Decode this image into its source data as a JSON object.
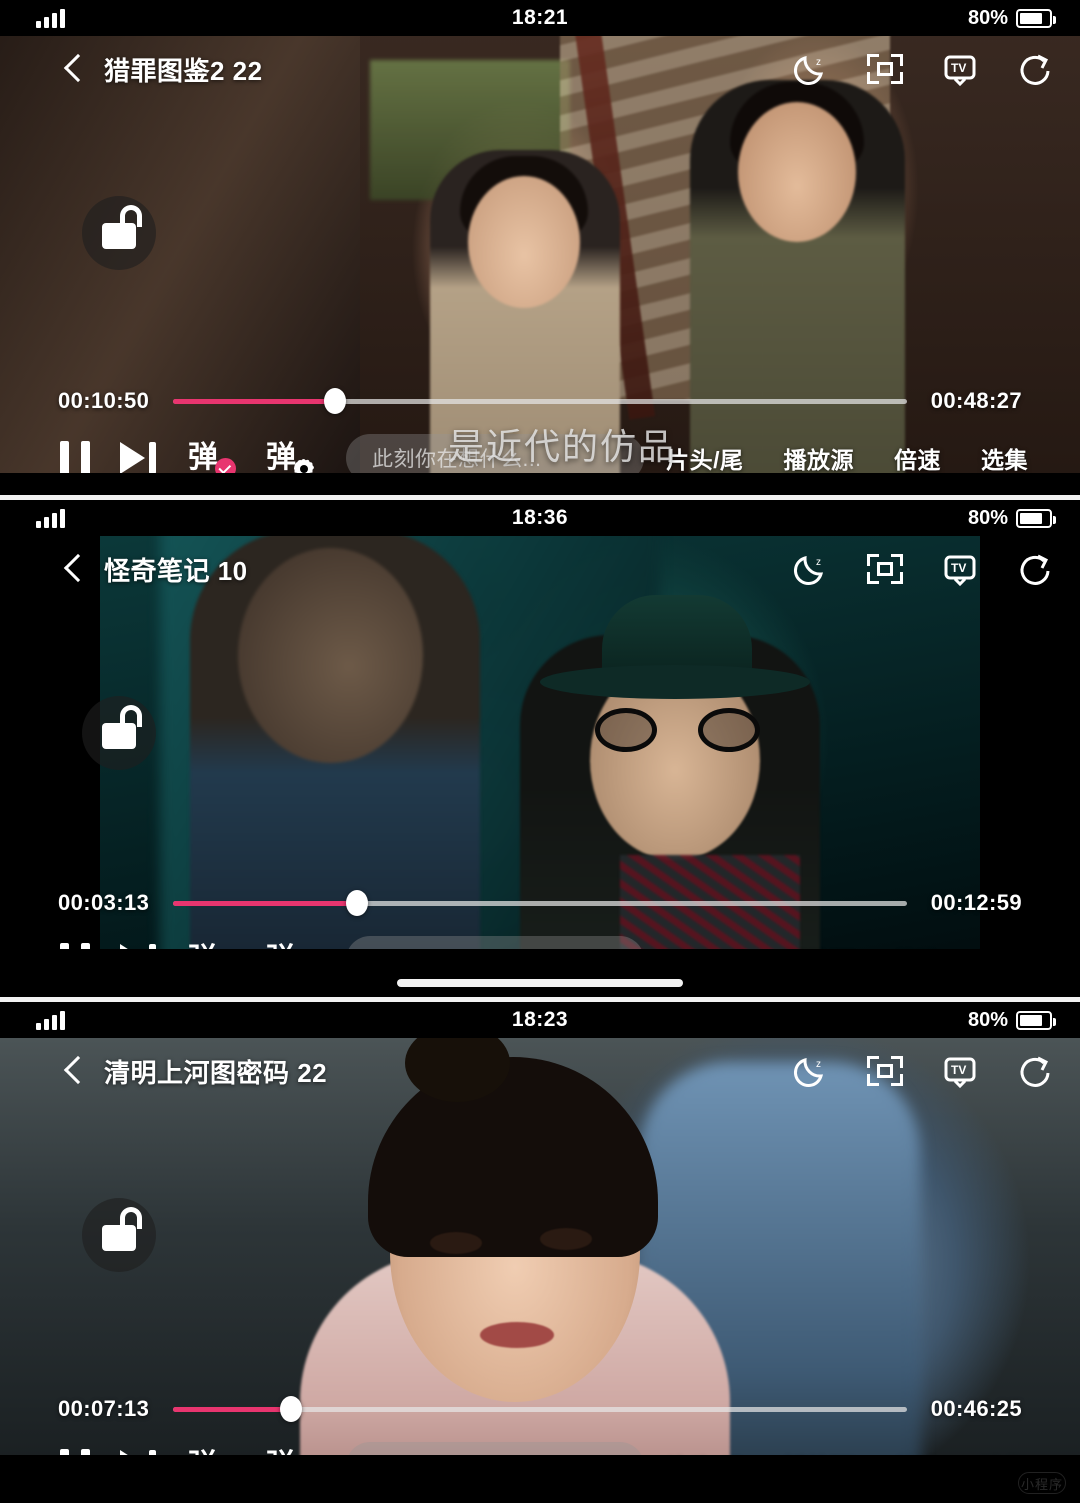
{
  "common": {
    "battery_text": "80%",
    "signal_icon": "signal-bars-icon",
    "battery_icon": "battery-icon",
    "back_icon": "back-chevron-icon",
    "lock_icon": "unlock-padlock-icon",
    "top_icons": [
      {
        "name": "sleep-timer-icon",
        "label": "sleep-timer"
      },
      {
        "name": "screen-crop-icon",
        "label": "screen-crop"
      },
      {
        "name": "tv-cast-icon",
        "label": "tv-cast"
      },
      {
        "name": "share-icon",
        "label": "share"
      }
    ],
    "controls": {
      "pause_icon": "pause-icon",
      "next_episode_icon": "next-episode-icon",
      "danmaku_toggle_label": "弹",
      "danmaku_settings_label": "弹",
      "input_placeholder": "此刻你在想什么...",
      "input_value": ""
    },
    "menu": {
      "skip_intro_outro": "片头/尾",
      "play_source": "播放源",
      "speed": "倍速",
      "episodes": "选集"
    },
    "accent_color": "#e8356f",
    "watermark": "小程序"
  },
  "panels": [
    {
      "status_time": "18:21",
      "title": "猎罪图鉴2 22",
      "current_time": "00:10:50",
      "total_time": "00:48:27",
      "progress_percent": 22,
      "danmaku_comment": "是近代的仿品",
      "has_home_indicator": false,
      "letterboxed": false
    },
    {
      "status_time": "18:36",
      "title": "怪奇笔记 10",
      "current_time": "00:03:13",
      "total_time": "00:12:59",
      "progress_percent": 25,
      "danmaku_comment": "",
      "has_home_indicator": true,
      "letterboxed": true
    },
    {
      "status_time": "18:23",
      "title": "清明上河图密码 22",
      "current_time": "00:07:13",
      "total_time": "00:46:25",
      "progress_percent": 16,
      "danmaku_comment": "",
      "has_home_indicator": false,
      "letterboxed": false
    }
  ]
}
